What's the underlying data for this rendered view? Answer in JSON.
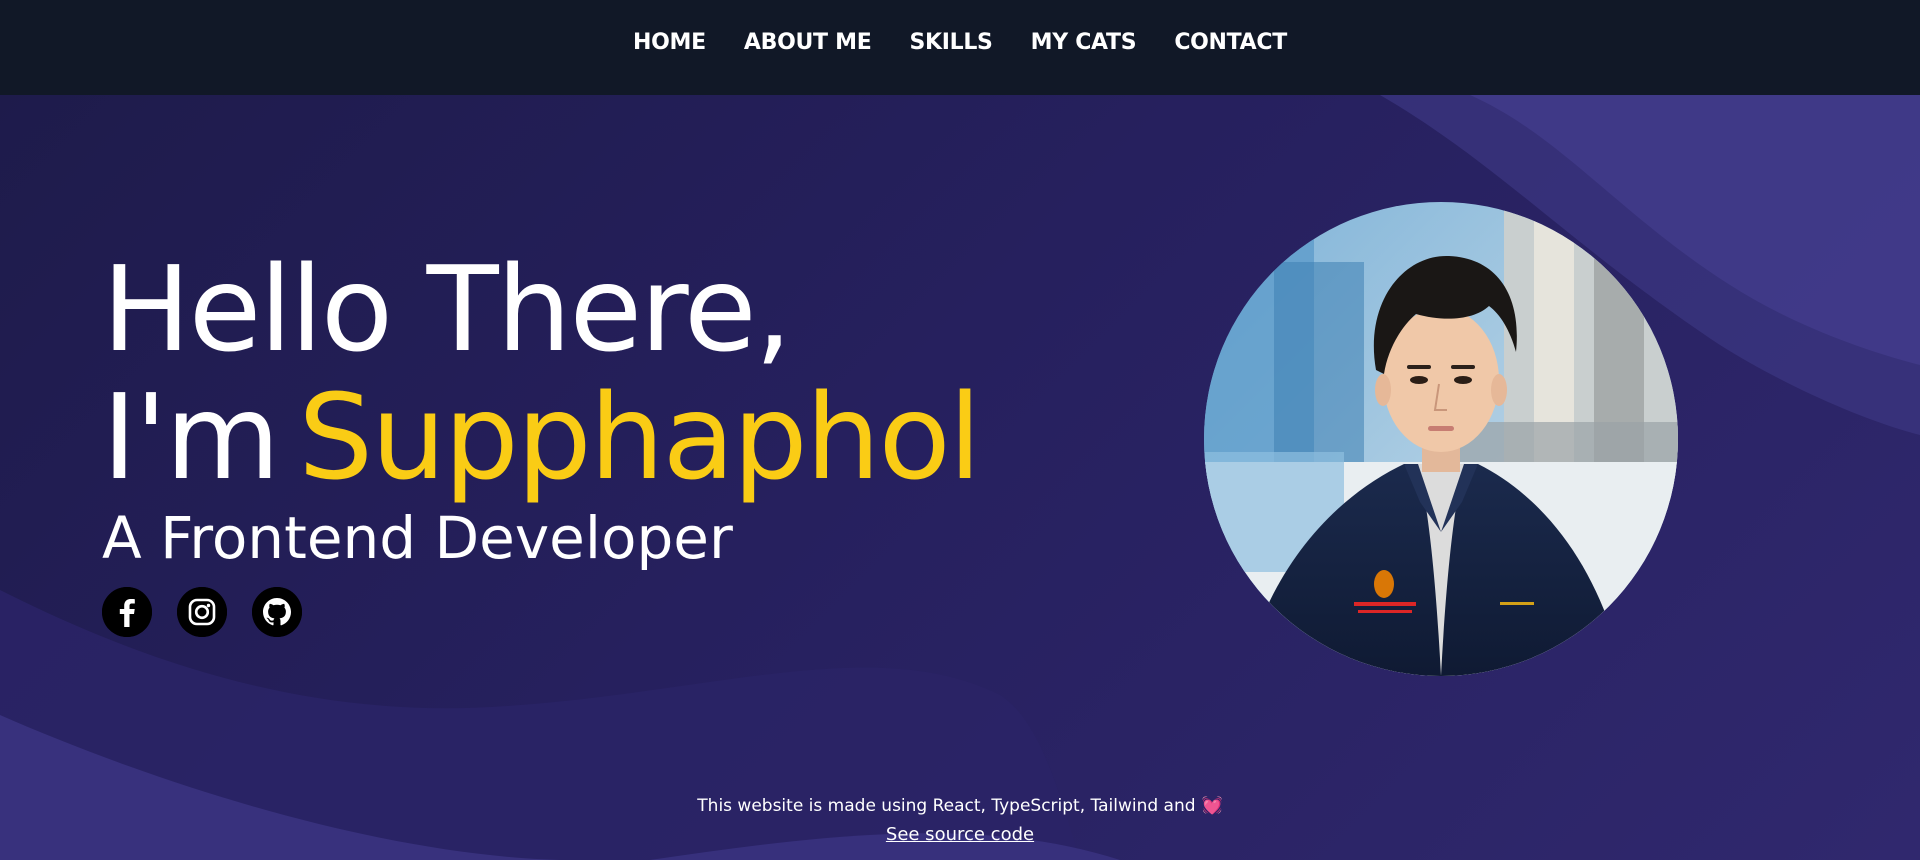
{
  "nav": {
    "items": [
      {
        "label": "HOME"
      },
      {
        "label": "ABOUT ME"
      },
      {
        "label": "SKILLS"
      },
      {
        "label": "MY CATS"
      },
      {
        "label": "CONTACT"
      }
    ]
  },
  "hero": {
    "greeting": "Hello There,",
    "intro_prefix": "I'm",
    "name": "Supphaphol",
    "role": "A Frontend Developer",
    "socials": [
      {
        "icon": "facebook-icon"
      },
      {
        "icon": "instagram-icon"
      },
      {
        "icon": "github-icon"
      }
    ],
    "profile_photo_icon": "profile-photo"
  },
  "footer": {
    "made_with": "This website is made using React, TypeScript, Tailwind and",
    "heart": "💓",
    "source_link": "See source code"
  },
  "colors": {
    "navbar_bg": "#111827",
    "hero_bg": "#1e1b4b",
    "accent": "#facc15",
    "heart": "#ec4899"
  }
}
